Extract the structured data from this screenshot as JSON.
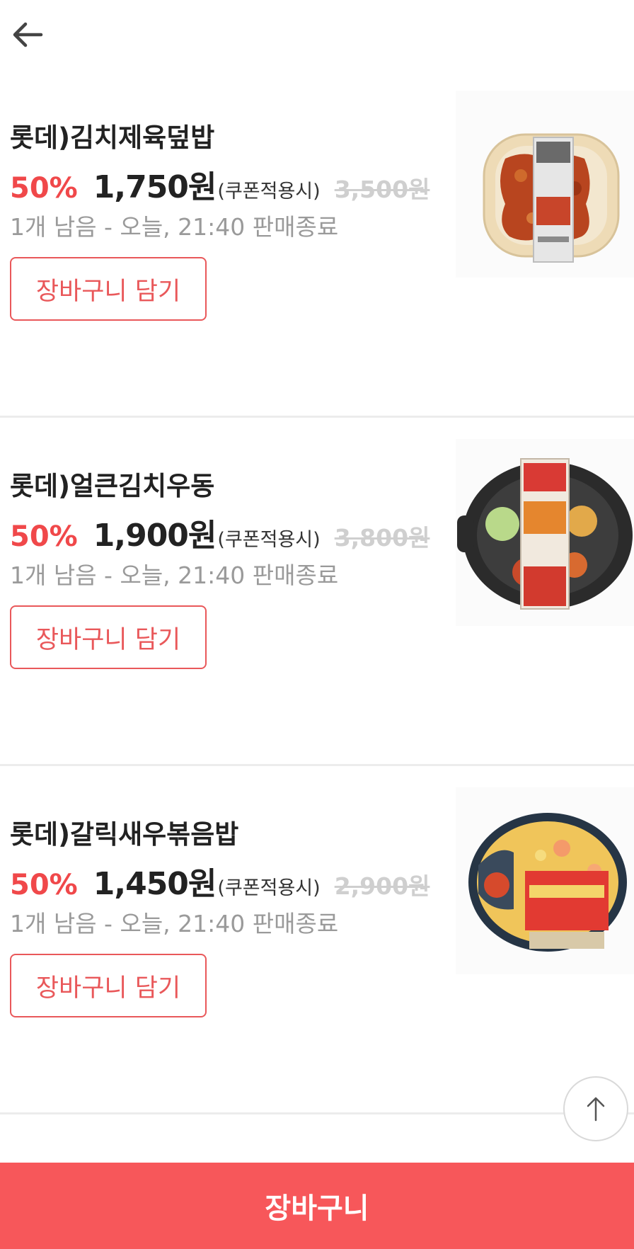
{
  "header": {
    "back_icon": "arrow-left-icon"
  },
  "products": [
    {
      "name": "롯데)김치제육덮밥",
      "discount": "50%",
      "price": "1,750원",
      "coupon_note": "(쿠폰적용시)",
      "original_price": "3,500원",
      "stock_info": "1개 남음 - 오늘, 21:40 판매종료",
      "cart_button_label": "장바구니 담기",
      "image": "kimchi-pork-rice-bowl-image"
    },
    {
      "name": "롯데)얼큰김치우동",
      "discount": "50%",
      "price": "1,900원",
      "coupon_note": "(쿠폰적용시)",
      "original_price": "3,800원",
      "stock_info": "1개 남음 - 오늘, 21:40 판매종료",
      "cart_button_label": "장바구니 담기",
      "image": "spicy-kimchi-udon-image"
    },
    {
      "name": "롯데)갈릭새우볶음밥",
      "discount": "50%",
      "price": "1,450원",
      "coupon_note": "(쿠폰적용시)",
      "original_price": "2,900원",
      "stock_info": "1개 남음 - 오늘, 21:40 판매종료",
      "cart_button_label": "장바구니 담기",
      "image": "garlic-shrimp-fried-rice-image"
    }
  ],
  "scroll_top": {
    "icon": "arrow-up-icon"
  },
  "bottom_bar": {
    "cart_label": "장바구니"
  },
  "colors": {
    "accent": "#f0484a",
    "bottom_bar": "#f7575a",
    "original_price": "#cfcfcf",
    "muted_text": "#9a9a9a"
  }
}
